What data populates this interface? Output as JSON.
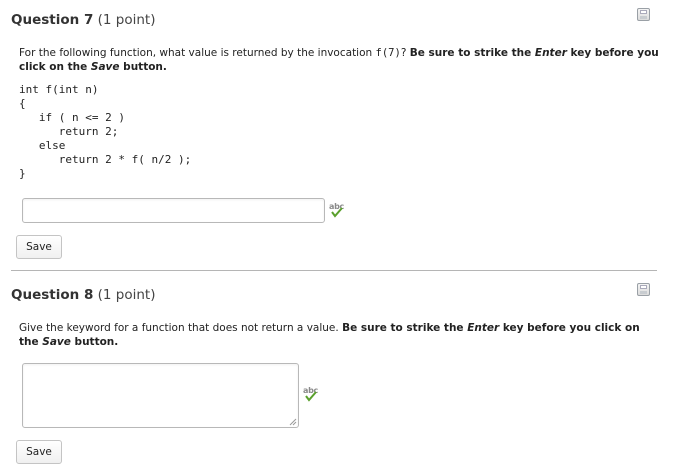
{
  "q7": {
    "title_bold": "Question 7",
    "title_points": "(1 point)",
    "prompt_part1": "For the following function, what value is returned by the invocation ",
    "invocation": "f(7)",
    "prompt_part2": "?  ",
    "strike_pre": "Be sure to strike the ",
    "enter": "Enter",
    "strike_mid": " key before you click on the ",
    "save_word": "Save",
    "strike_post": " button.",
    "code": "int f(int n)\n{\n   if ( n <= 2 )\n      return 2;\n   else\n      return 2 * f( n/2 );\n}",
    "answer_value": "",
    "save_label": "Save"
  },
  "q8": {
    "title_bold": "Question 8",
    "title_points": "(1 point)",
    "prompt_main": "Give the keyword for a function that does not return a value.  ",
    "strike_pre": "Be sure to strike the ",
    "enter": "Enter",
    "strike_mid": " key before you click on the ",
    "save_word": "Save",
    "strike_post": " button.",
    "answer_value": "",
    "save_label": "Save"
  },
  "spell_icon_text": "abc",
  "colors": {
    "check_green": "#5aa02c",
    "border": "#b8b8b8",
    "divider": "#b5b5b5"
  }
}
